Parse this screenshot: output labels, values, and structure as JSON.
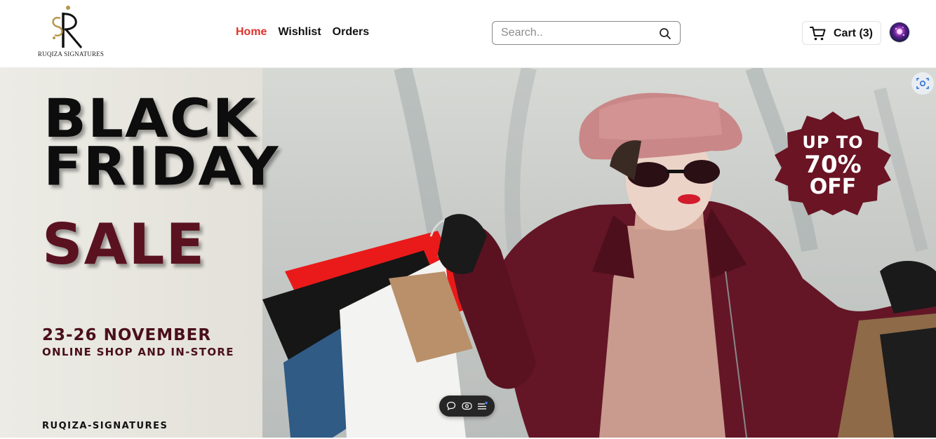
{
  "brand": {
    "logo_text": "RUQIZA SIGNATURES",
    "logo_letters": "R S",
    "logo_icon": "monogram-logo"
  },
  "nav": {
    "items": [
      {
        "label": "Home",
        "active": true
      },
      {
        "label": "Wishlist",
        "active": false
      },
      {
        "label": "Orders",
        "active": false
      }
    ]
  },
  "search": {
    "placeholder": "Search..",
    "value": "",
    "icon": "search-icon"
  },
  "cart": {
    "label": "Cart (3)",
    "icon": "cart-icon"
  },
  "account": {
    "avatar_icon": "avatar-galaxy-image"
  },
  "banner": {
    "title_line1": "BLACK",
    "title_line2": "FRIDAY",
    "title_line3": "SALE",
    "dates": "23-26 NOVEMBER",
    "subline": "ONLINE SHOP AND IN-STORE",
    "brand_footer": "RUQIZA-SIGNATURES",
    "badge_line1": "UP TO",
    "badge_line2": "70%",
    "badge_line3": "OFF",
    "image_icon": "shopping-woman-photo"
  },
  "overlay": {
    "lens_icon": "visual-search-icon",
    "toolbar_icons": [
      "comment-icon",
      "eye-icon",
      "menu-icon"
    ]
  },
  "colors": {
    "accent": "#e0322b",
    "maroon": "#5a1220",
    "badge": "#6a1424",
    "text": "#111111"
  }
}
